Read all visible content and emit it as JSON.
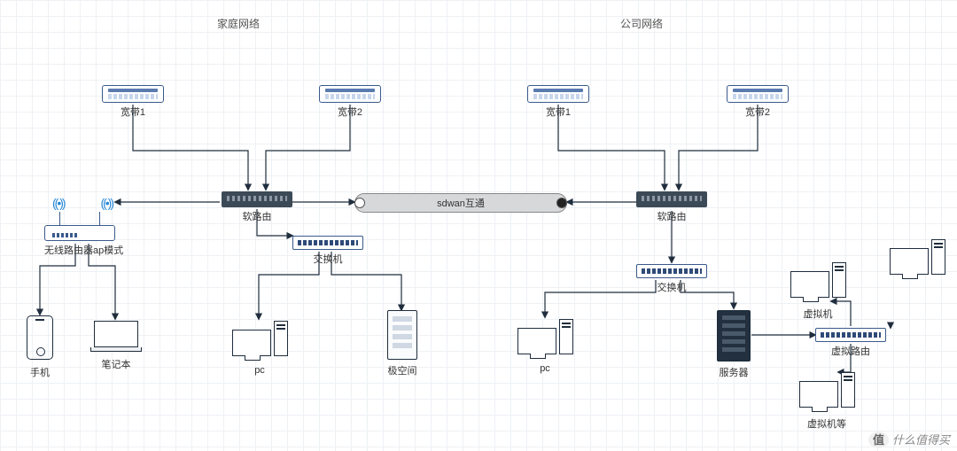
{
  "titles": {
    "home": "家庭网络",
    "office": "公司网络"
  },
  "sdwan": {
    "label": "sdwan互通"
  },
  "home": {
    "wan1": "宽带1",
    "wan2": "宽带2",
    "soft_router": "软路由",
    "wireless_ap": "无线路由器ap模式",
    "switch": "交换机",
    "phone": "手机",
    "laptop": "笔记本",
    "pc": "pc",
    "nas": "极空间"
  },
  "office": {
    "wan1": "宽带1",
    "wan2": "宽带2",
    "soft_router": "软路由",
    "switch": "交换机",
    "pc": "pc",
    "server": "服务器",
    "vrouter": "虚拟路由",
    "vm": "虚拟机",
    "vm_etc": "虚拟机等"
  },
  "watermark": {
    "badge": "值",
    "text": "什么值得买"
  },
  "colors": {
    "line": "#1f2d3d"
  }
}
